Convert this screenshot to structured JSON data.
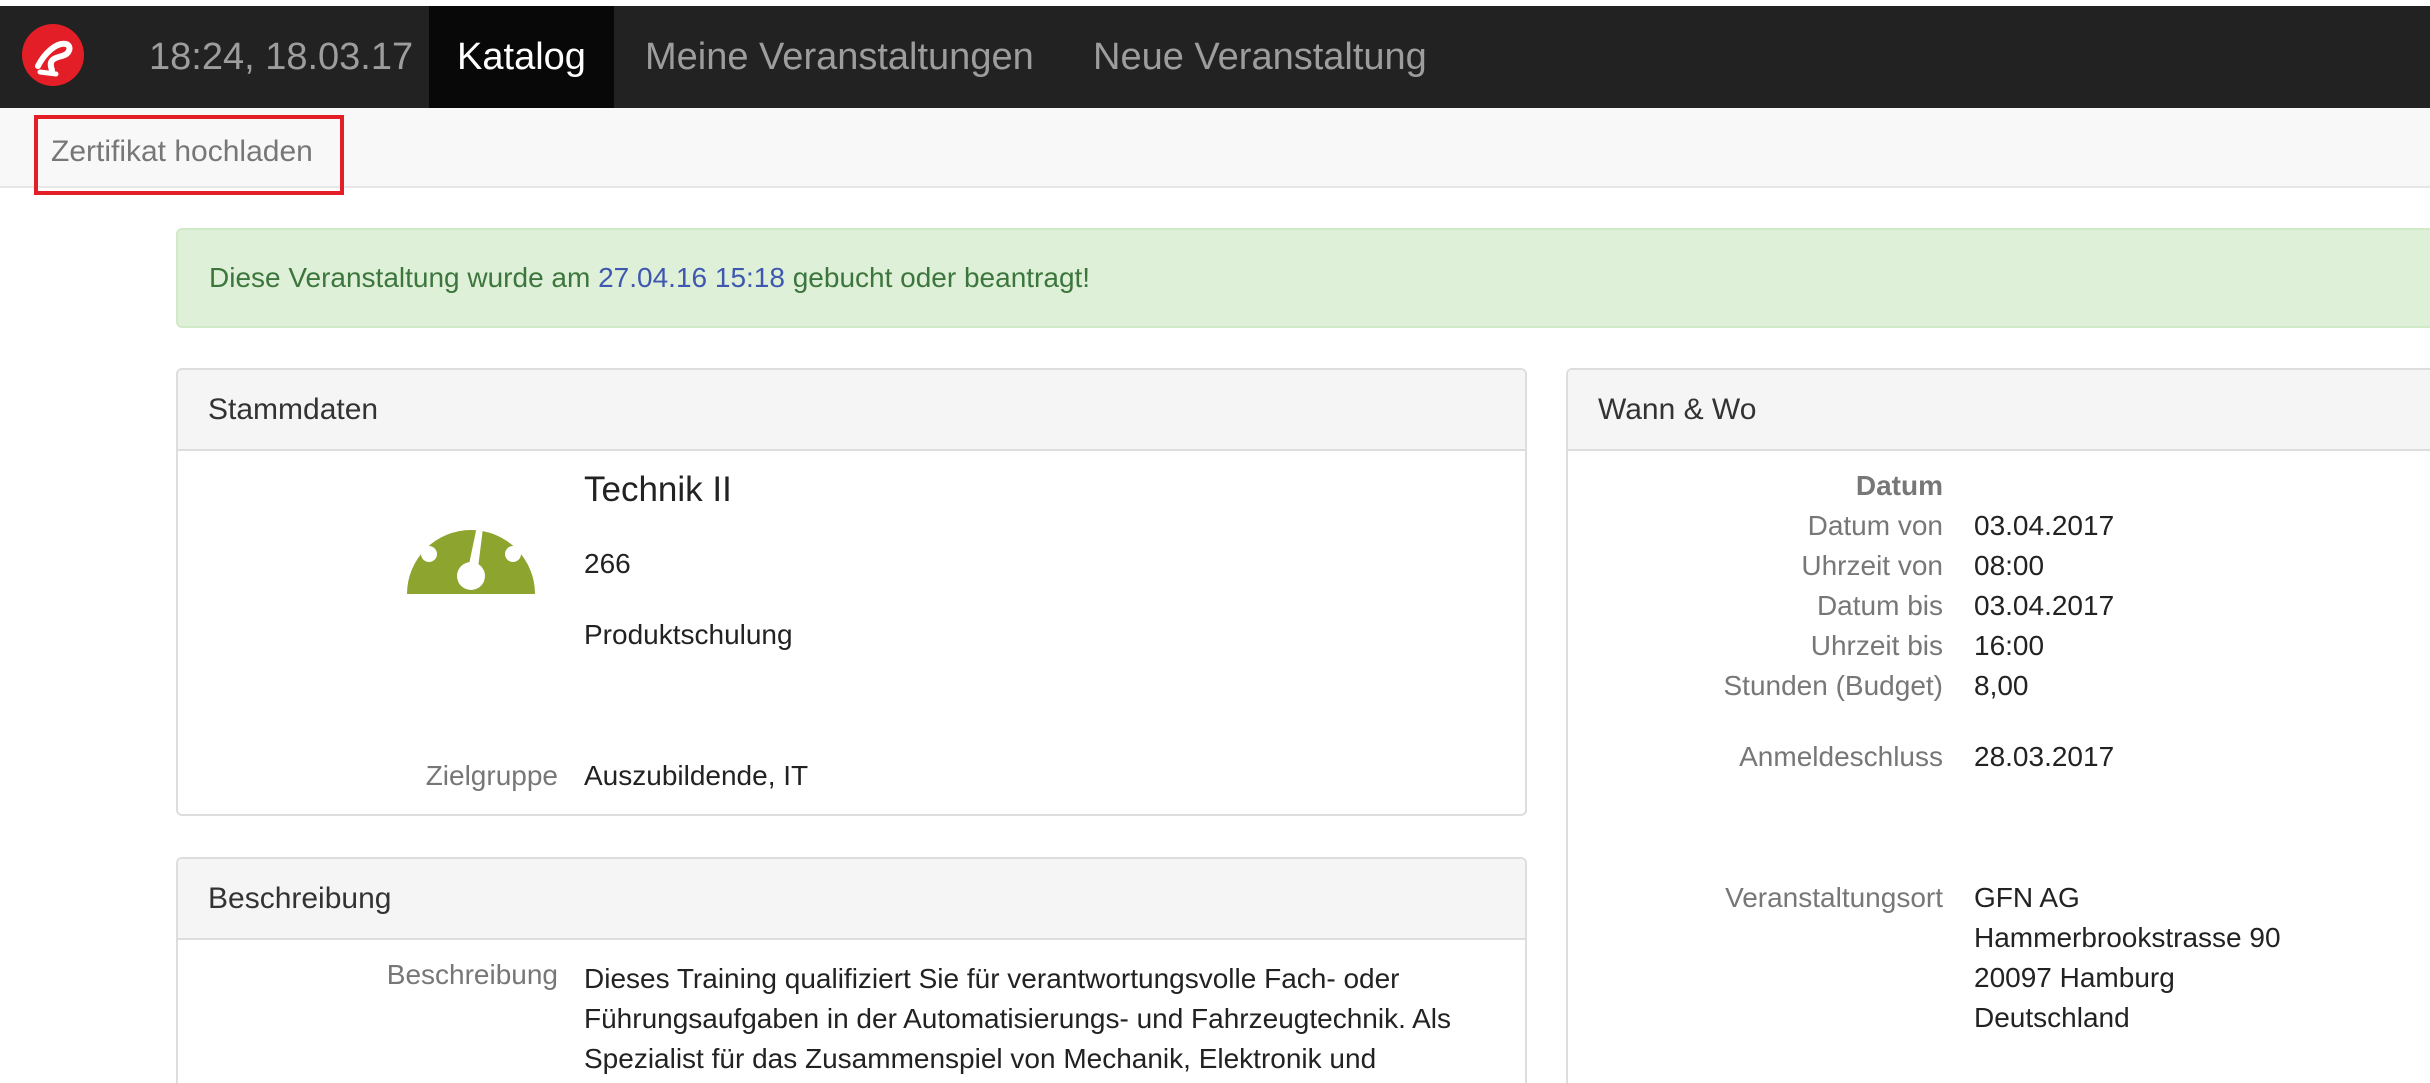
{
  "navbar": {
    "time": "18:24, 18.03.17",
    "tabs": [
      {
        "label": "Katalog"
      },
      {
        "label": "Meine Veranstaltungen"
      },
      {
        "label": "Neue Veranstaltung"
      }
    ],
    "brand_color": "#e41e26"
  },
  "subnav": {
    "upload_label": "Zertifikat hochladen"
  },
  "alert": {
    "prefix": "Diese Veranstaltung wurde am ",
    "date": "27.04.16 15:18",
    "suffix": " gebucht oder beantragt!"
  },
  "stammdaten": {
    "heading": "Stammdaten",
    "icon": "speedometer-icon",
    "title": "Technik II",
    "number": "266",
    "type": "Produktschulung",
    "zielgruppe_label": "Zielgruppe",
    "zielgruppe_value": "Auszubildende, IT"
  },
  "wann_wo": {
    "heading": "Wann & Wo",
    "datum_header": "Datum",
    "rows": [
      {
        "label": "Datum von",
        "value": "03.04.2017"
      },
      {
        "label": "Uhrzeit von",
        "value": "08:00"
      },
      {
        "label": "Datum bis",
        "value": "03.04.2017"
      },
      {
        "label": "Uhrzeit bis",
        "value": "16:00"
      },
      {
        "label": "Stunden (Budget)",
        "value": "8,00"
      }
    ],
    "anmeldeschluss_label": "Anmeldeschluss",
    "anmeldeschluss_value": "28.03.2017",
    "ort_label": "Veranstaltungsort",
    "ort_lines": [
      "GFN AG",
      "Hammerbrookstrasse 90",
      "20097 Hamburg",
      "Deutschland"
    ]
  },
  "beschreibung": {
    "heading": "Beschreibung",
    "label": "Beschreibung",
    "lines": [
      "Dieses Training qualifiziert Sie für verantwortungsvolle Fach- oder",
      "Führungsaufgaben in der Automatisierungs- und Fahrzeugtechnik. Als",
      "Spezialist für das Zusammenspiel von Mechanik, Elektronik und"
    ]
  }
}
